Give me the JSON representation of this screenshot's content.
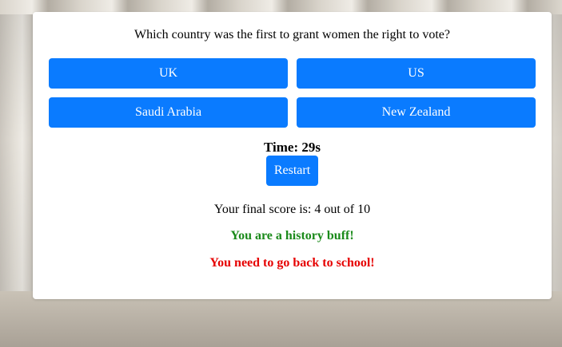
{
  "quiz": {
    "question": "Which country was the first to grant women the right to vote?",
    "answers": [
      "UK",
      "US",
      "Saudi Arabia",
      "New Zealand"
    ],
    "timer": "Time: 29s",
    "restart_label": "Restart",
    "score_text": "Your final score is: 4 out of 10",
    "message_good": "You are a history buff!",
    "message_bad": "You need to go back to school!"
  },
  "colors": {
    "button": "#0a7bff",
    "good": "#1a8a1a",
    "bad": "#e60000",
    "panel": "#ffffff"
  }
}
